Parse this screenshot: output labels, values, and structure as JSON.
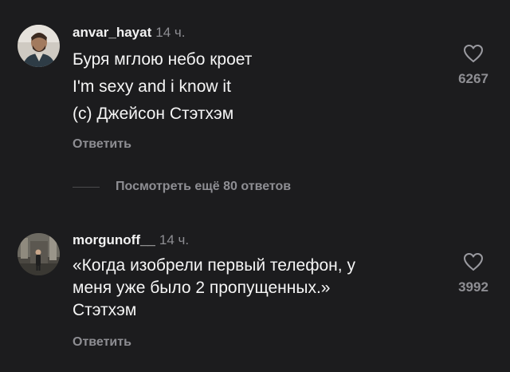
{
  "comments": [
    {
      "username": "anvar_hayat",
      "time": "14 ч.",
      "lines": [
        "Буря мглою небо кроет",
        "I'm sexy and i know it",
        "(с) Джейсон Стэтхэм"
      ],
      "reply_label": "Ответить",
      "likes": "6267",
      "avatar_icon": "avatar-photo-man-beard"
    },
    {
      "username": "morgunoff__",
      "time": "14 ч.",
      "lines": [
        "«Когда изобрели первый телефон, у",
        "меня уже было 2 пропущенных.»",
        "Стэтхэм"
      ],
      "reply_label": "Ответить",
      "likes": "3992",
      "avatar_icon": "avatar-photo-man-standing"
    }
  ],
  "more_replies": "Посмотреть ещё 80 ответов",
  "colors": {
    "background": "#1c1c1e",
    "text": "#f5f5f5",
    "muted": "#8e8e93"
  }
}
